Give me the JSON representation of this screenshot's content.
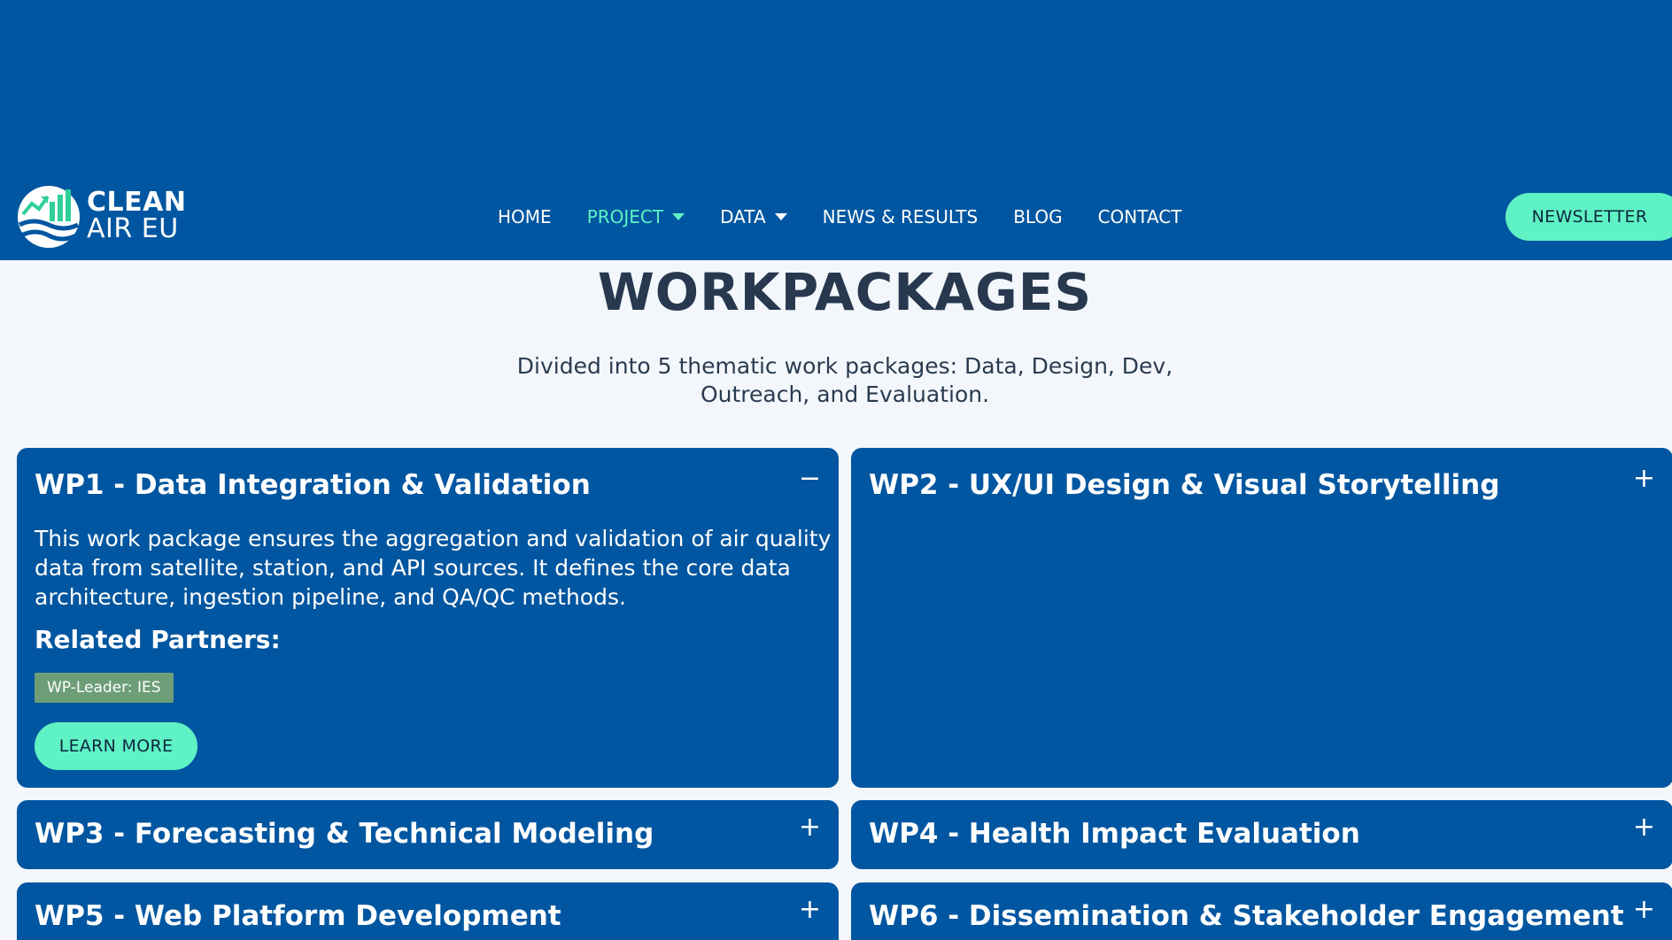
{
  "brand": {
    "line1": "CLEAN",
    "line2": "AIR EU"
  },
  "nav": {
    "items": [
      {
        "label": "HOME"
      },
      {
        "label": "PROJECT"
      },
      {
        "label": "DATA"
      },
      {
        "label": "NEWS & RESULTS"
      },
      {
        "label": "BLOG"
      },
      {
        "label": "CONTACT"
      }
    ],
    "newsletter": "NEWSLETTER"
  },
  "page": {
    "title": "WORKPACKAGES",
    "intro": "Divided into 5 thematic work packages: Data, Design, Dev, Outreach, and Evaluation."
  },
  "workpackages": [
    {
      "title": "WP1 - Data Integration & Validation",
      "toggle": "−",
      "description": "This work package ensures the aggregation and validation of air quality data from satellite, station, and API sources. It defines the core data architecture, ingestion pipeline, and QA/QC methods.",
      "partners_heading": "Related Partners:",
      "badge": "WP-Leader: IES",
      "learn_more": "LEARN MORE"
    },
    {
      "title": "WP2 - UX/UI Design & Visual Storytelling",
      "toggle": "+"
    },
    {
      "title": "WP3 - Forecasting & Technical Modeling",
      "toggle": "+"
    },
    {
      "title": "WP4 - Health Impact Evaluation",
      "toggle": "+"
    },
    {
      "title": "WP5 - Web Platform Development",
      "toggle": "+"
    },
    {
      "title": "WP6 - Dissemination & Stakeholder Engagement",
      "toggle": "+"
    }
  ],
  "colors": {
    "primary": "#0056a0",
    "accent": "#5ef2c4",
    "background": "#f3f7fc",
    "badge": "#6d9e78",
    "heading": "#27384f"
  }
}
